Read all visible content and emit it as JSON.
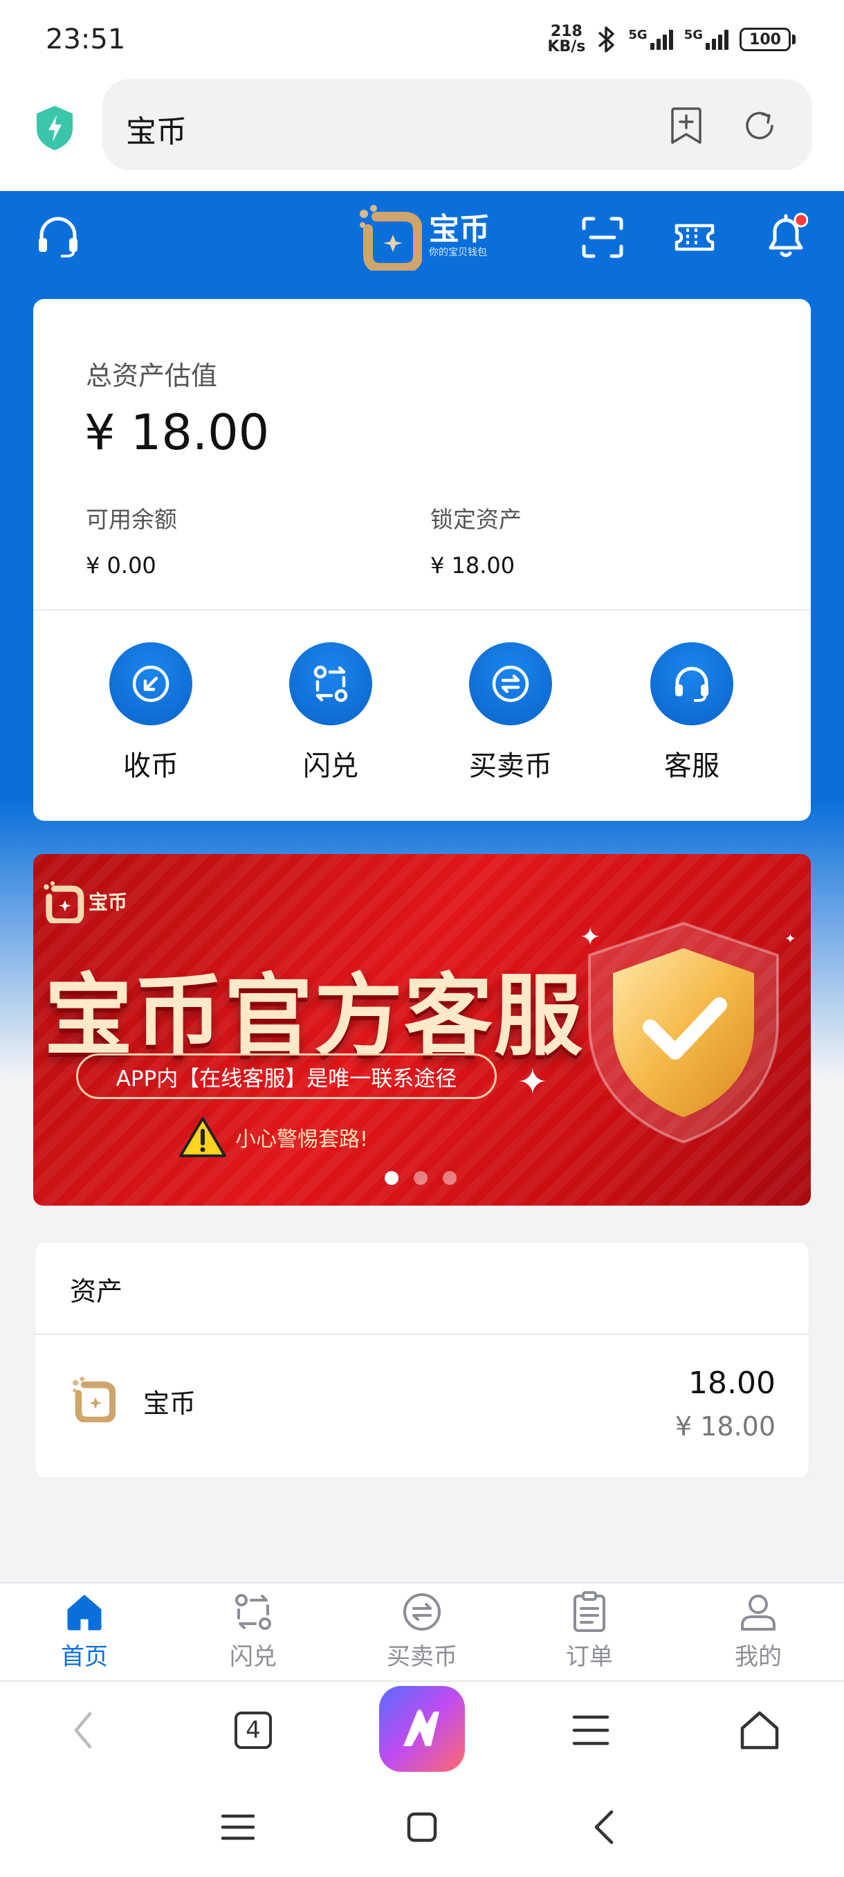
{
  "status_bar": {
    "time": "23:51",
    "net_speed_value": "218",
    "net_speed_unit": "KB/s",
    "sim1": "5G",
    "sim2": "5G",
    "battery": "100"
  },
  "browser": {
    "address_text": "宝币"
  },
  "header": {
    "brand_name": "宝币",
    "brand_sub": "你的宝贝钱包"
  },
  "assets_summary": {
    "total_label": "总资产估值",
    "total_value": "¥ 18.00",
    "available_label": "可用余额",
    "available_value": "¥ 0.00",
    "locked_label": "锁定资产",
    "locked_value": "¥ 18.00"
  },
  "actions": [
    {
      "label": "收币",
      "icon": "receive-icon"
    },
    {
      "label": "闪兑",
      "icon": "swap-icon"
    },
    {
      "label": "买卖币",
      "icon": "trade-icon"
    },
    {
      "label": "客服",
      "icon": "headset-icon"
    }
  ],
  "banner": {
    "logo_text": "宝币",
    "title": "宝币官方客服",
    "pill_text": "APP内【在线客服】是唯一联系途径",
    "warning_text": "小心警惕套路!",
    "active_slide": 1,
    "slide_count": 3
  },
  "assets_list": {
    "title": "资产",
    "items": [
      {
        "name": "宝币",
        "amount": "18.00",
        "value": "¥ 18.00"
      }
    ]
  },
  "tabbar": {
    "items": [
      {
        "label": "首页",
        "icon": "home-icon",
        "active": true
      },
      {
        "label": "闪兑",
        "icon": "swap-icon",
        "active": false
      },
      {
        "label": "买卖币",
        "icon": "trade-icon",
        "active": false
      },
      {
        "label": "订单",
        "icon": "clipboard-icon",
        "active": false
      },
      {
        "label": "我的",
        "icon": "user-icon",
        "active": false
      }
    ]
  },
  "browser_nav": {
    "tab_count": "4"
  },
  "colors": {
    "primary": "#0a6fdb",
    "banner_red": "#d8141a",
    "inactive_tab": "#8b8e94"
  }
}
